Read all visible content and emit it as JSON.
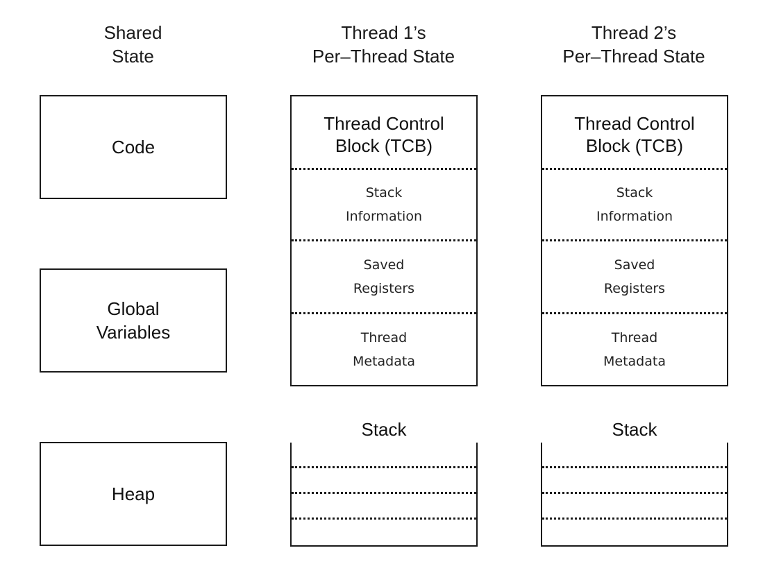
{
  "columns": [
    {
      "id": "shared",
      "header": "Shared\nState"
    },
    {
      "id": "thread1",
      "header": "Thread 1’s\nPer–Thread State"
    },
    {
      "id": "thread2",
      "header": "Thread 2’s\nPer–Thread State"
    }
  ],
  "shared": {
    "boxes": [
      {
        "label": "Code"
      },
      {
        "label": "Global\nVariables"
      },
      {
        "label": "Heap"
      }
    ]
  },
  "threads": [
    {
      "tcb": {
        "title": "Thread Control\nBlock (TCB)",
        "sections": [
          "Stack\nInformation",
          "Saved\nRegisters",
          "Thread\nMetadata"
        ]
      },
      "stack": {
        "label": "Stack",
        "frame_dividers": 3
      }
    },
    {
      "tcb": {
        "title": "Thread Control\nBlock (TCB)",
        "sections": [
          "Stack\nInformation",
          "Saved\nRegisters",
          "Thread\nMetadata"
        ]
      },
      "stack": {
        "label": "Stack",
        "frame_dividers": 3
      }
    }
  ]
}
